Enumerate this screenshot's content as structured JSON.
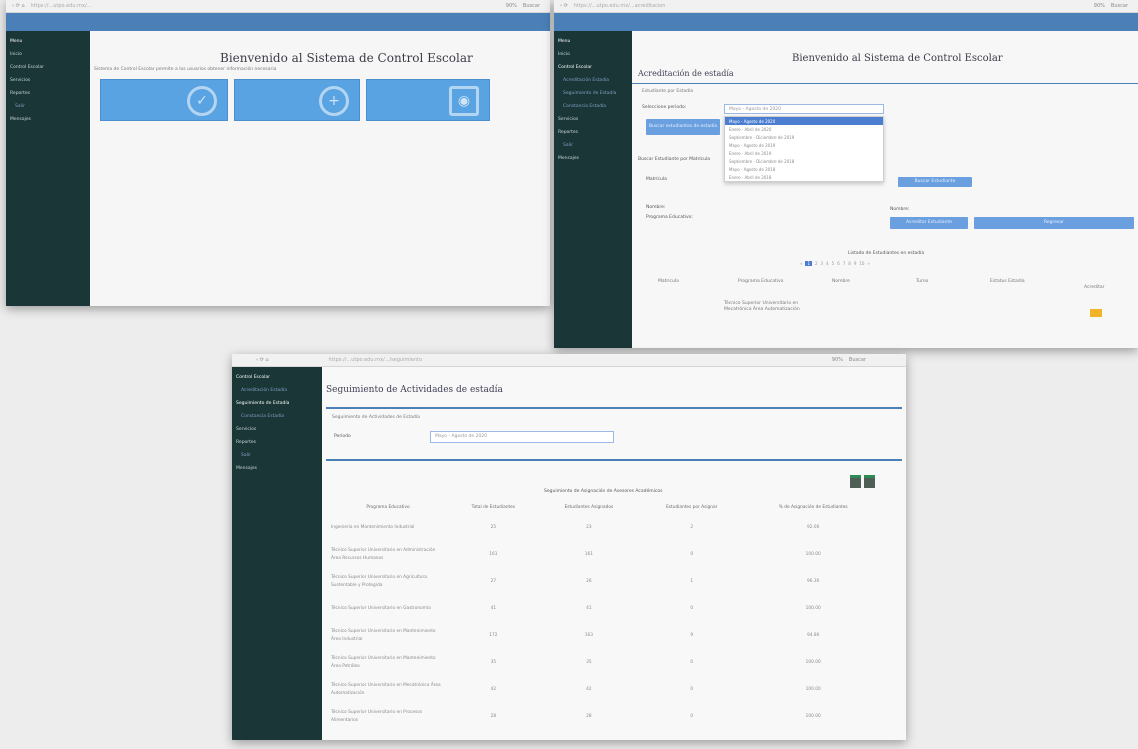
{
  "screens": [
    {
      "url": "https://...utpo.edu.mx/...",
      "zoom": "90%",
      "search": "Buscar",
      "sidebar": [
        "Menu",
        "Inicio",
        "Control Escolar",
        "Servicios",
        "Reportes",
        "Salir",
        "Mensajes"
      ],
      "title": "Bienvenido al Sistema de Control Escolar",
      "subtitle": "Sistema de Control Escolar permite a los usuarios obtener información necesaria"
    },
    {
      "url": "https://...utpo.edu.mx/...acreditacion",
      "zoom": "90%",
      "search": "Buscar",
      "sidebar": [
        "Menu",
        "Inicio",
        "Control Escolar",
        "Acreditación Estadía",
        "Seguimiento de Estadía",
        "Constancia Estadía",
        "Servicios",
        "Reportes",
        "Salir",
        "Mensajes"
      ],
      "title": "Bienvenido al Sistema de Control Escolar",
      "page_title": "Acreditación de estadía",
      "section": "Estudiante por Estadía",
      "period_label": "Seleccione periodo:",
      "period_value": "Mayo - Agosto de 2020",
      "period_options": [
        "Mayo - Agosto de 2020",
        "Enero - Abril de 2020",
        "Septiembre - Diciembre de 2019",
        "Mayo - Agosto de 2019",
        "Enero - Abril de 2019",
        "Septiembre - Diciembre de 2018",
        "Mayo - Agosto de 2018",
        "Enero - Abril de 2018"
      ],
      "btn_students": "Buscar estudiantes de estadía",
      "search_label": "Buscar Estudiante por Matrícula",
      "matricula": "Matrícula",
      "btn_search": "Buscar Estudiante",
      "nombre_label": "Nombre:",
      "nombre_value": "Nombre:",
      "programa_label": "Programa Educativo:",
      "btn_accredit": "Acreditar Estudiante",
      "btn_back": "Regresar",
      "list_title": "Listado de Estudiantes en estadía",
      "pages": [
        "«",
        "1",
        "2",
        "3",
        "4",
        "5",
        "6",
        "7",
        "8",
        "9",
        "10",
        "»"
      ],
      "headers": [
        "Matrícula",
        "Programa Educativo",
        "Nombre",
        "Turno",
        "Estatus Estadía",
        "Acreditar"
      ],
      "row": [
        "Técnico Superior Universitario en Mecatrónica Área Automatización"
      ]
    },
    {
      "url": "https://...utpo.edu.mx/.../seguimiento",
      "zoom": "90%",
      "search": "Buscar",
      "sidebar": [
        "Control Escolar",
        "Acreditación Estadía",
        "Seguimiento de Estadía",
        "Constancia Estadía",
        "Servicios",
        "Reportes",
        "Salir",
        "Mensajes"
      ],
      "page_title": "Seguimiento de Actividades de estadía",
      "section": "Seguimiento de Actividades de Estadía",
      "period_label": "Periodo",
      "period_value": "Mayo - Agosto de 2020",
      "table_title": "Seguimiento de Asignación de Asesores Académicos",
      "headers": [
        "Programa Educativo",
        "Total de Estudiantes",
        "Estudiantes Asignados",
        "Estudiantes por Asignar",
        "% de Asignación de Estudiantes"
      ],
      "rows": [
        [
          "Ingeniería en Mantenimiento Industrial",
          "25",
          "23",
          "2",
          "92.00"
        ],
        [
          "Técnico Superior Universitario en Administración Área Recursos Humanos",
          "161",
          "161",
          "0",
          "100.00"
        ],
        [
          "Técnico Superior Universitario en Agricultura Sustentable y Protegida",
          "27",
          "26",
          "1",
          "96.30"
        ],
        [
          "Técnico Superior Universitario en Gastronomía",
          "41",
          "41",
          "0",
          "100.00"
        ],
        [
          "Técnico Superior Universitario en Mantenimiento Área Industrial",
          "172",
          "163",
          "9",
          "94.80"
        ],
        [
          "Técnico Superior Universitario en Mantenimiento Área Petróleo",
          "35",
          "35",
          "0",
          "100.00"
        ],
        [
          "Técnico Superior Universitario en Mecatrónica Área Automatización",
          "42",
          "42",
          "0",
          "100.00"
        ],
        [
          "Técnico Superior Universitario en Procesos Alimentarios",
          "28",
          "28",
          "0",
          "100.00"
        ]
      ]
    }
  ]
}
